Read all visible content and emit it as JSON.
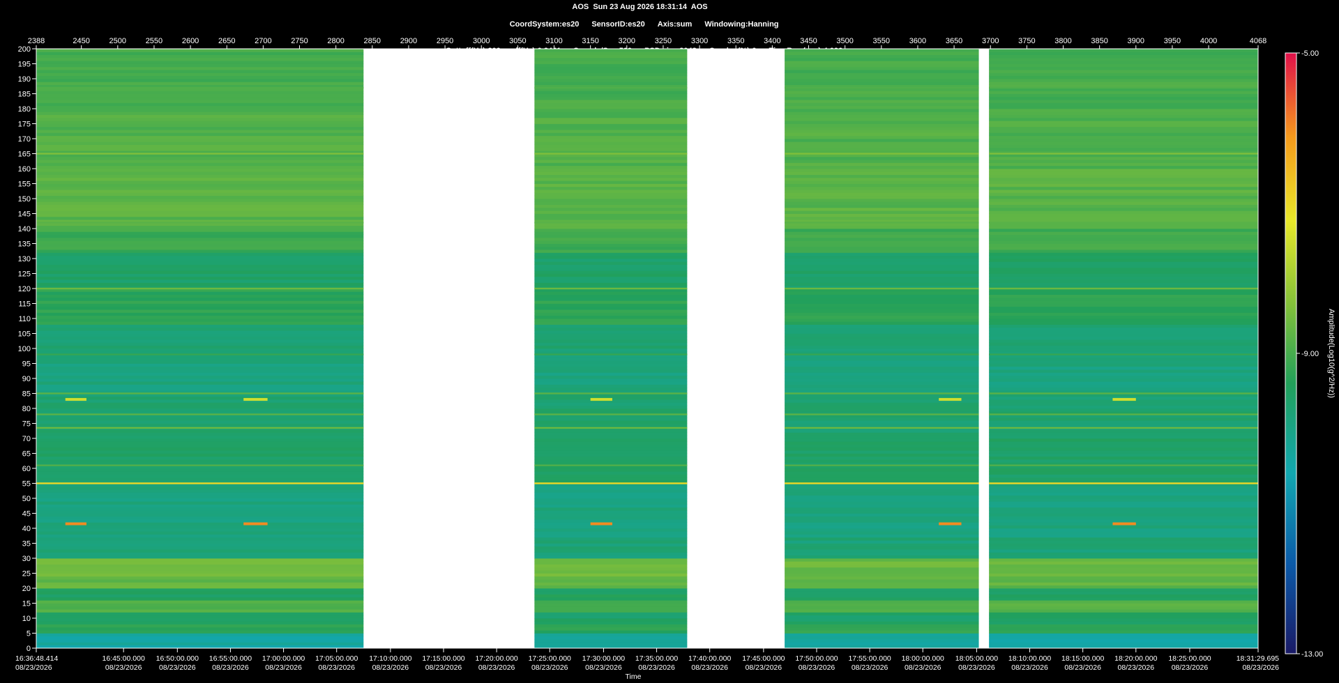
{
  "header": {
    "line1": "AOS  Sun 23 Aug 2026 18:31:14  AOS",
    "line2": [
      "CoordSystem:es20",
      "SensorID:es20",
      "Axis:sum",
      "Windowing:Hanning"
    ],
    "line3": [
      "Cuttoff(Hz):200",
      "df(Hz):0.2441",
      "Sample/Sec:500",
      "PSD size:2048",
      "Overlap(%):0",
      "TimeRes.(sec):4.096"
    ]
  },
  "chart_data": {
    "type": "heatmap",
    "title": "AOS  Sun 23 Aug 2026 18:31:14  AOS",
    "xlabel": "Time",
    "ylabel": "",
    "colorbar_label": "Amplitude(Log10(g^2/Hz))",
    "colorbar_ticks": [
      "-5.00",
      "-9.00",
      "-13.00"
    ],
    "colorbar_range": [
      -13,
      -5
    ],
    "top_axis": {
      "range": [
        2388,
        4068
      ],
      "ticks": [
        2388,
        2450,
        2500,
        2550,
        2600,
        2650,
        2700,
        2750,
        2800,
        2850,
        2900,
        2950,
        3000,
        3050,
        3100,
        3150,
        3200,
        3250,
        3300,
        3350,
        3400,
        3450,
        3500,
        3550,
        3600,
        3650,
        3700,
        3750,
        3800,
        3850,
        3900,
        3950,
        4000,
        4068
      ]
    },
    "y_axis": {
      "range": [
        0,
        200
      ],
      "ticks": [
        0,
        5,
        10,
        15,
        20,
        25,
        30,
        35,
        40,
        45,
        50,
        55,
        60,
        65,
        70,
        75,
        80,
        85,
        90,
        95,
        100,
        105,
        110,
        115,
        120,
        125,
        130,
        135,
        140,
        145,
        150,
        155,
        160,
        165,
        170,
        175,
        180,
        185,
        190,
        195,
        200
      ]
    },
    "x_ticks": [
      {
        "time": "16:36:48.414",
        "date": "08/23/2026",
        "index": 2388
      },
      {
        "time": "16:45:00.000",
        "date": "08/23/2026",
        "index": 2508
      },
      {
        "time": "16:50:00.000",
        "date": "08/23/2026",
        "index": 2582
      },
      {
        "time": "16:55:00.000",
        "date": "08/23/2026",
        "index": 2655
      },
      {
        "time": "17:00:00.000",
        "date": "08/23/2026",
        "index": 2728
      },
      {
        "time": "17:05:00.000",
        "date": "08/23/2026",
        "index": 2801
      },
      {
        "time": "17:10:00.000",
        "date": "08/23/2026",
        "index": 2875
      },
      {
        "time": "17:15:00.000",
        "date": "08/23/2026",
        "index": 2948
      },
      {
        "time": "17:20:00.000",
        "date": "08/23/2026",
        "index": 3021
      },
      {
        "time": "17:25:00.000",
        "date": "08/23/2026",
        "index": 3094
      },
      {
        "time": "17:30:00.000",
        "date": "08/23/2026",
        "index": 3168
      },
      {
        "time": "17:35:00.000",
        "date": "08/23/2026",
        "index": 3241
      },
      {
        "time": "17:40:00.000",
        "date": "08/23/2026",
        "index": 3314
      },
      {
        "time": "17:45:00.000",
        "date": "08/23/2026",
        "index": 3388
      },
      {
        "time": "17:50:00.000",
        "date": "08/23/2026",
        "index": 3461
      },
      {
        "time": "17:55:00.000",
        "date": "08/23/2026",
        "index": 3534
      },
      {
        "time": "18:00:00.000",
        "date": "08/23/2026",
        "index": 3607
      },
      {
        "time": "18:05:00.000",
        "date": "08/23/2026",
        "index": 3681
      },
      {
        "time": "18:10:00.000",
        "date": "08/23/2026",
        "index": 3754
      },
      {
        "time": "18:15:00.000",
        "date": "08/23/2026",
        "index": 3827
      },
      {
        "time": "18:20:00.000",
        "date": "08/23/2026",
        "index": 3900
      },
      {
        "time": "18:25:00.000",
        "date": "08/23/2026",
        "index": 3974
      },
      {
        "time": "18:31:29.695",
        "date": "08/23/2026",
        "index": 4068
      }
    ],
    "data_segments": [
      [
        2388,
        2838
      ],
      [
        3073,
        3283
      ],
      [
        3417,
        3684
      ],
      [
        3698,
        4068
      ]
    ],
    "gap_color": "#ffffff",
    "spectral_lines_hz": [
      {
        "hz": 55,
        "level": -7.0
      },
      {
        "hz": 73.5,
        "level": -8.6
      },
      {
        "hz": 78,
        "level": -8.8
      },
      {
        "hz": 85,
        "level": -8.8
      },
      {
        "hz": 61,
        "level": -8.9
      },
      {
        "hz": 120,
        "level": -8.6
      },
      {
        "hz": 142,
        "level": -8.8
      },
      {
        "hz": 165,
        "level": -8.4
      },
      {
        "hz": 98,
        "level": -9.2
      },
      {
        "hz": 187,
        "level": -8.9
      }
    ],
    "event_blips": [
      {
        "start": 2428,
        "end": 2457,
        "hz": 41.5,
        "level": -6.0
      },
      {
        "start": 2428,
        "end": 2457,
        "hz": 83,
        "level": -7.5
      },
      {
        "start": 2673,
        "end": 2706,
        "hz": 41.5,
        "level": -6.0
      },
      {
        "start": 2673,
        "end": 2706,
        "hz": 83,
        "level": -7.5
      },
      {
        "start": 3150,
        "end": 3180,
        "hz": 41.5,
        "level": -6.0
      },
      {
        "start": 3150,
        "end": 3180,
        "hz": 83,
        "level": -7.5
      },
      {
        "start": 3629,
        "end": 3660,
        "hz": 41.5,
        "level": -6.0
      },
      {
        "start": 3629,
        "end": 3660,
        "hz": 83,
        "level": -7.5
      },
      {
        "start": 3868,
        "end": 3900,
        "hz": 41.5,
        "level": -6.0
      },
      {
        "start": 3868,
        "end": 3900,
        "hz": 83,
        "level": -7.5
      }
    ],
    "grid": false
  }
}
